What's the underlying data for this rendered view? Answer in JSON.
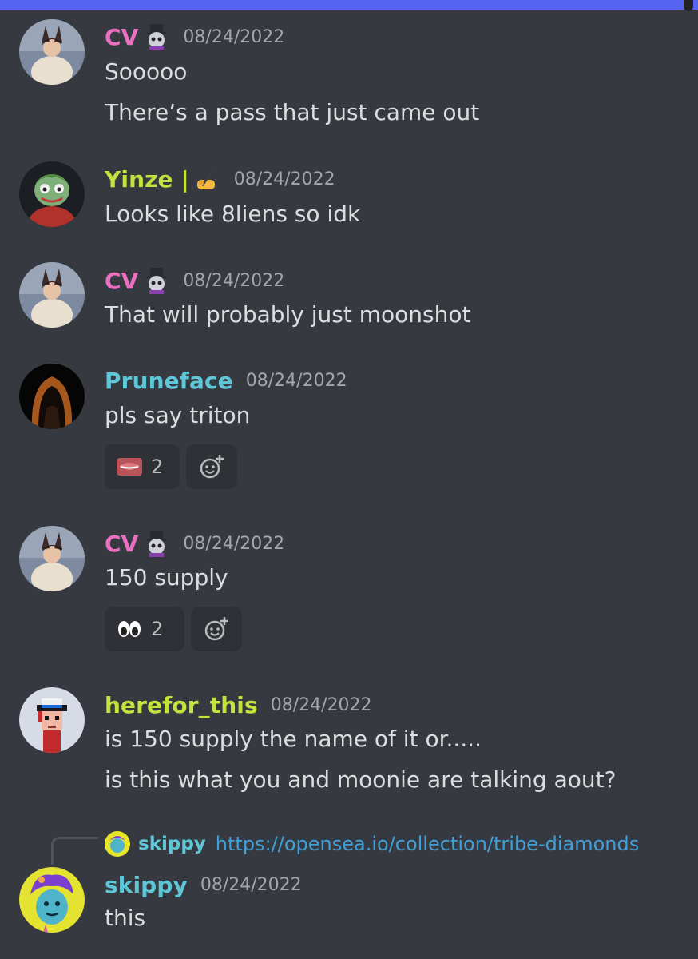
{
  "colors": {
    "background": "#36393f",
    "accent_bar": "#5865f2",
    "name_pink": "#ec6fc2",
    "name_yellow": "#c5e23d",
    "name_teal": "#5fc6d8",
    "timestamp": "#a3a6aa",
    "link": "#3fa0d9"
  },
  "messages": [
    {
      "author": "CV",
      "author_badge_icon": "skull-top-hat-badge-icon",
      "timestamp": "08/24/2022",
      "lines": [
        "Sooooo",
        "There’s a pass that just came out"
      ]
    },
    {
      "author": "Yinze |",
      "author_badge_icon": "writing-hand-emoji-icon",
      "timestamp": "08/24/2022",
      "lines": [
        "Looks like 8liens so idk"
      ]
    },
    {
      "author": "CV",
      "author_badge_icon": "skull-top-hat-badge-icon",
      "timestamp": "08/24/2022",
      "lines": [
        "That will probably just moonshot"
      ]
    },
    {
      "author": "Pruneface",
      "timestamp": "08/24/2022",
      "lines": [
        "pls say triton"
      ],
      "reactions": [
        {
          "emoji_icon": "lips-emoji-icon",
          "count": "2"
        }
      ]
    },
    {
      "author": "CV",
      "author_badge_icon": "skull-top-hat-badge-icon",
      "timestamp": "08/24/2022",
      "lines": [
        "150 supply"
      ],
      "reactions": [
        {
          "emoji_icon": "eyes-emoji-icon",
          "count": "2"
        }
      ]
    },
    {
      "author": "herefor_this",
      "timestamp": "08/24/2022",
      "lines": [
        "is 150 supply the name of it or.....",
        "is this what you and moonie are talking aout?"
      ]
    },
    {
      "author": "skippy",
      "timestamp": "08/24/2022",
      "lines": [
        "this"
      ],
      "reply_to": {
        "author": "skippy",
        "text": "https://opensea.io/collection/tribe-diamonds"
      }
    }
  ]
}
